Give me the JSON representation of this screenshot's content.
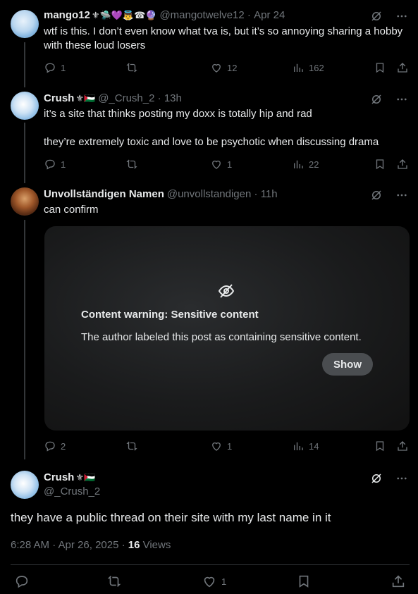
{
  "tweets": [
    {
      "name": "mango12",
      "emojis": "⚜🛸💜👼☎🔮",
      "handle": "@mangotwelve12",
      "time": "Apr 24",
      "text": "wtf is this. I don’t even know what tva is, but it’s so annoying sharing a hobby with these loud losers",
      "replies": "1",
      "likes": "12",
      "views": "162"
    },
    {
      "name": "Crush",
      "emojis": "⚜🇵🇸",
      "handle": "@_Crush_2",
      "time": "13h",
      "text1": "it’s a site that thinks posting my doxx is totally hip and rad",
      "text2": "they’re extremely toxic and love to be psychotic when discussing drama",
      "replies": "1",
      "likes": "1",
      "views": "22"
    },
    {
      "name": "Unvollständigen Namen",
      "handle": "@unvollstandigen",
      "time": "11h",
      "text": "can confirm",
      "warning_title": "Content warning: Sensitive content",
      "warning_text": "The author labeled this post as containing sensitive content.",
      "show_label": "Show",
      "replies": "2",
      "likes": "1",
      "views": "14"
    }
  ],
  "main": {
    "name": "Crush",
    "emojis": "⚜🇵🇸",
    "handle": "@_Crush_2",
    "text": "they have a public thread on their site with my last name in it",
    "timestamp": "6:28 AM · Apr 26, 2025 · ",
    "views_count": "16",
    "views_label": " Views",
    "likes": "1"
  },
  "colors": {
    "accent": "#1d9bf0",
    "muted": "#71767b",
    "text": "#e7e9ea"
  }
}
